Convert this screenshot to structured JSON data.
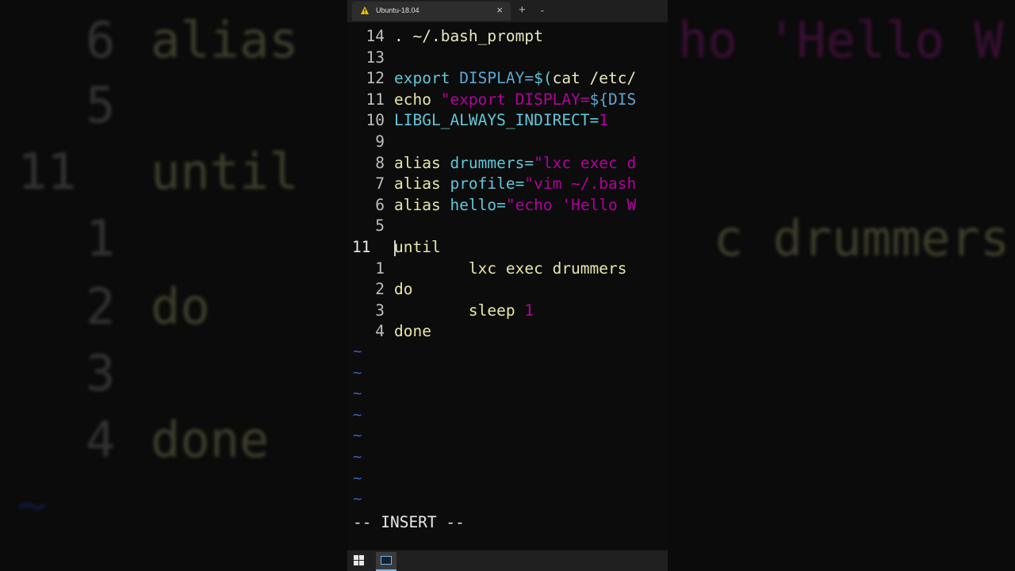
{
  "window": {
    "tab_title": "Ubuntu-18.04",
    "tab_close": "×",
    "new_tab": "+",
    "dropdown": "⌄"
  },
  "editor": {
    "lines": [
      {
        "num": "14",
        "parts": [
          {
            "t": ". ~/.bash_prompt",
            "c": "c-plain"
          }
        ]
      },
      {
        "num": "13",
        "parts": []
      },
      {
        "num": "12",
        "parts": [
          {
            "t": "export ",
            "c": "c-cyan"
          },
          {
            "t": "DISPLAY=",
            "c": "c-kw"
          },
          {
            "t": "$(",
            "c": "c-cyan"
          },
          {
            "t": "cat /etc/",
            "c": "c-plain"
          }
        ]
      },
      {
        "num": "11",
        "parts": [
          {
            "t": "echo ",
            "c": "c-yellow"
          },
          {
            "t": "\"",
            "c": "c-str"
          },
          {
            "t": "export DISPLAY=",
            "c": "c-str"
          },
          {
            "t": "${DIS",
            "c": "c-kw"
          }
        ]
      },
      {
        "num": "10",
        "parts": [
          {
            "t": "LIBGL_ALWAYS_INDIRECT=",
            "c": "c-cyan"
          },
          {
            "t": "1",
            "c": "c-str"
          }
        ]
      },
      {
        "num": "9",
        "parts": []
      },
      {
        "num": "8",
        "parts": [
          {
            "t": "alias ",
            "c": "c-yellow"
          },
          {
            "t": "drummers=",
            "c": "c-cyan"
          },
          {
            "t": "\"lxc exec d",
            "c": "c-str"
          }
        ]
      },
      {
        "num": "7",
        "parts": [
          {
            "t": "alias ",
            "c": "c-yellow"
          },
          {
            "t": "profile=",
            "c": "c-cyan"
          },
          {
            "t": "\"vim ~/.bash",
            "c": "c-str"
          }
        ]
      },
      {
        "num": "6",
        "parts": [
          {
            "t": "alias ",
            "c": "c-yellow"
          },
          {
            "t": "hello=",
            "c": "c-cyan"
          },
          {
            "t": "\"echo 'Hello W",
            "c": "c-str"
          }
        ]
      },
      {
        "num": "5",
        "parts": []
      },
      {
        "num": "11",
        "cur": true,
        "parts": [
          {
            "t": "until",
            "c": "c-yellow"
          }
        ]
      },
      {
        "num": "1",
        "parts": [
          {
            "t": "        lxc exec drummers",
            "c": "c-yellow"
          }
        ]
      },
      {
        "num": "2",
        "parts": [
          {
            "t": "do",
            "c": "c-yellow"
          }
        ]
      },
      {
        "num": "3",
        "parts": [
          {
            "t": "        sleep ",
            "c": "c-yellow"
          },
          {
            "t": "1",
            "c": "c-str"
          }
        ]
      },
      {
        "num": "4",
        "parts": [
          {
            "t": "done",
            "c": "c-yellow"
          }
        ]
      }
    ],
    "tildes": [
      "~",
      "~",
      "~",
      "~",
      "~",
      "~",
      "~",
      "~"
    ],
    "mode": "-- INSERT --"
  },
  "background": {
    "rows": [
      {
        "num": "6",
        "text": "alias",
        "pink": "ho 'Hello W"
      },
      {
        "num": "5",
        "text": "",
        "pink": ""
      },
      {
        "num": "11",
        "text": "until",
        "pink": ""
      },
      {
        "num": "1",
        "text": "",
        "pink": ""
      },
      {
        "num": "2",
        "text": "do",
        "pink": ""
      },
      {
        "num": "3",
        "text": "",
        "pink": ""
      },
      {
        "num": "4",
        "text": "done",
        "pink": ""
      }
    ],
    "right_text": "c drummers"
  }
}
